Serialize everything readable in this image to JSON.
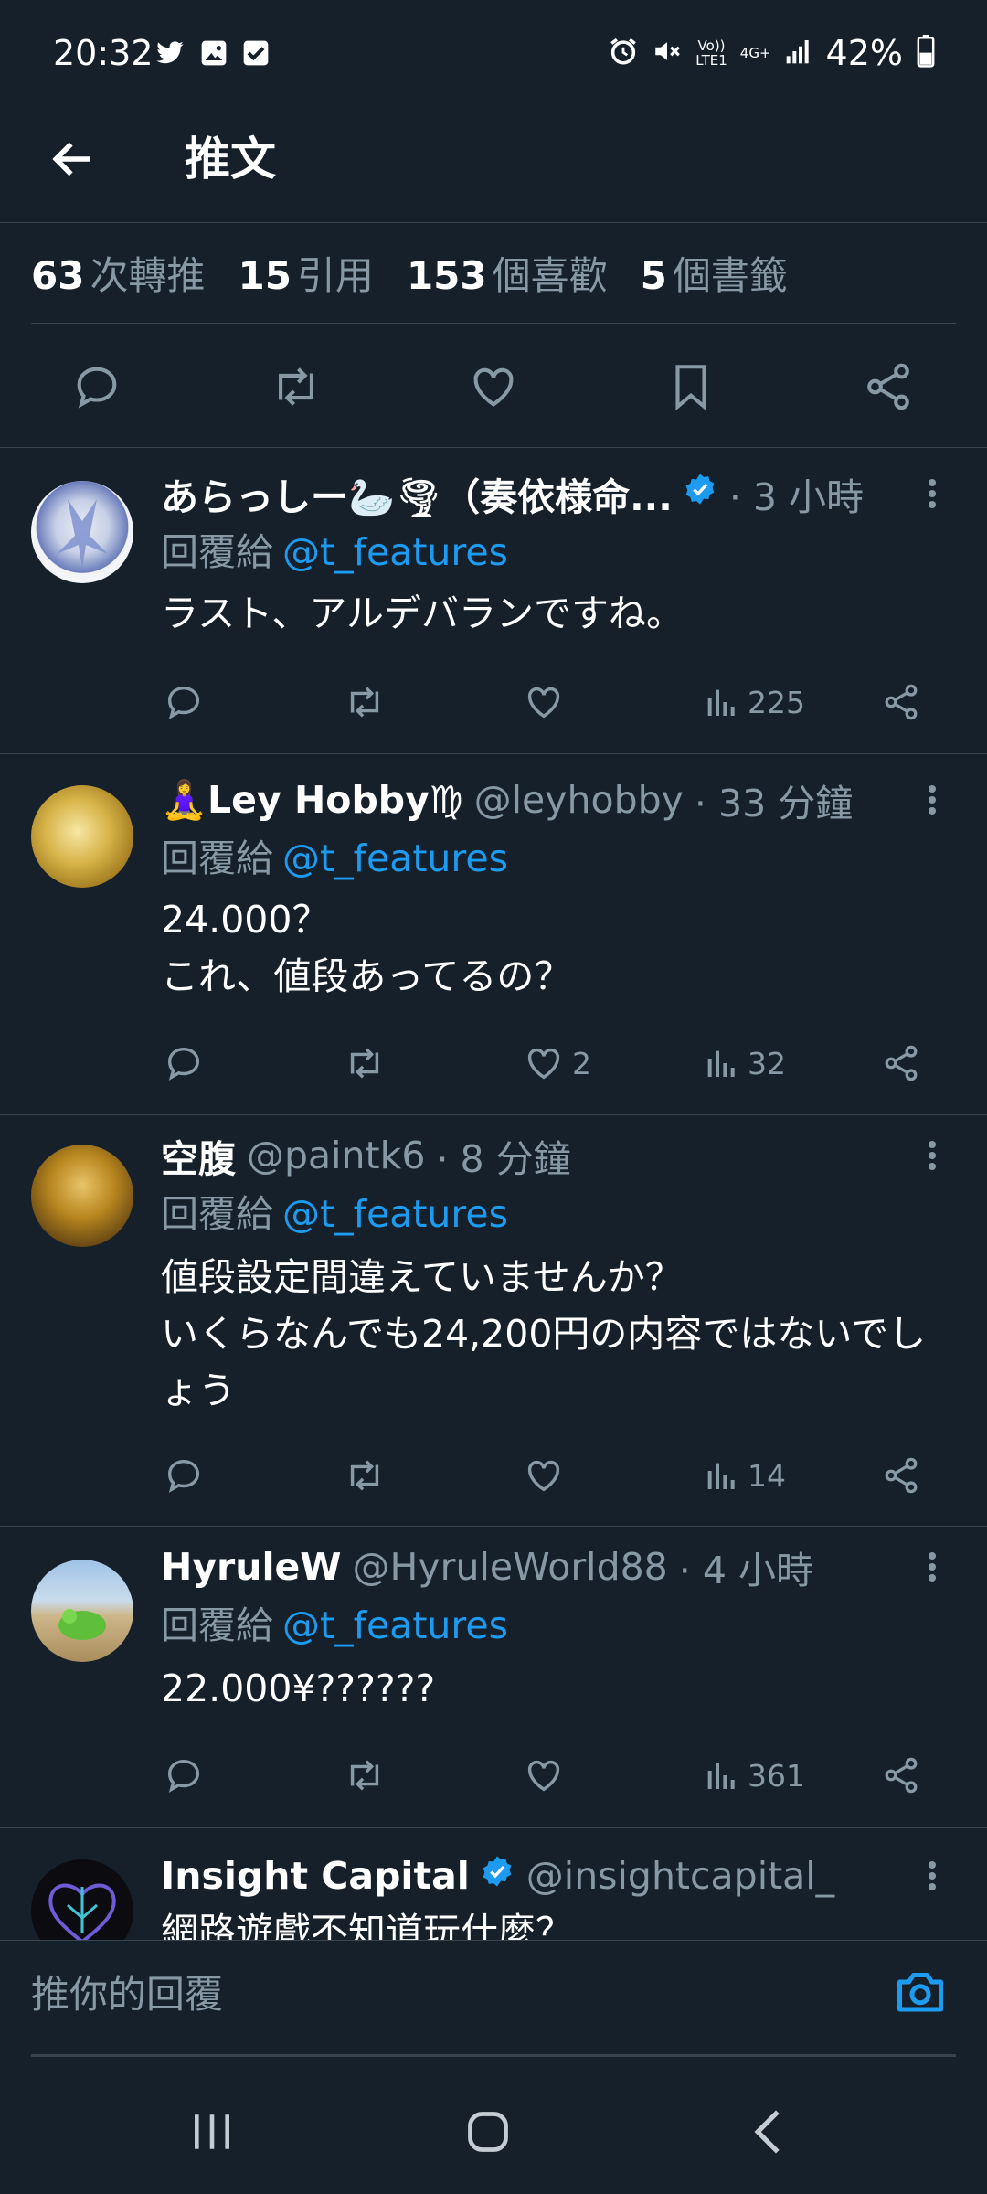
{
  "status_bar": {
    "time": "20:32",
    "battery_percent": "42%",
    "volte_label": "Vo))\nLTE1",
    "network_label": "4G+",
    "left_icons": [
      "twitter-icon",
      "gallery-icon",
      "checkbox-icon"
    ],
    "right_icons": [
      "alarm-icon",
      "mute-icon",
      "volte-icon",
      "4g-icon",
      "signal-icon",
      "battery-icon"
    ]
  },
  "header": {
    "title": "推文"
  },
  "stats": [
    {
      "value": "63",
      "label": "次轉推"
    },
    {
      "value": "15",
      "label": "引用"
    },
    {
      "value": "153",
      "label": "個喜歡"
    },
    {
      "value": "5",
      "label": "個書籤"
    }
  ],
  "action_bar_icons": [
    "reply-icon",
    "retweet-icon",
    "like-icon",
    "bookmark-icon",
    "share-icon"
  ],
  "reply_to_label": "回覆給",
  "replies": [
    {
      "name": "あらっしー🦢🌪（奏依様命...",
      "handle": "",
      "time": "· 3 小時",
      "verified": true,
      "mention": "@t_features",
      "text": "ラスト、アルデバランですね。",
      "likes": "",
      "views": "225"
    },
    {
      "name": "🧘‍♀️Ley Hobby♍",
      "handle": "@leyhobby",
      "time": "· 33 分鐘",
      "verified": false,
      "mention": "@t_features",
      "text": "24.000？\nこれ、値段あってるの？",
      "likes": "2",
      "views": "32"
    },
    {
      "name": "空腹",
      "handle": "@paintk6",
      "time": "· 8 分鐘",
      "verified": false,
      "mention": "@t_features",
      "text": "値段設定間違えていませんか？\nいくらなんでも24,200円の内容ではないでしょう",
      "likes": "",
      "views": "14"
    },
    {
      "name": "HyruleW",
      "handle": "@HyruleWorld88",
      "time": "· 4 小時",
      "verified": false,
      "mention": "@t_features",
      "text": "22.000¥??????",
      "likes": "",
      "views": "361"
    },
    {
      "name": "Insight Capital",
      "handle": "@insightcapital_",
      "time": "",
      "verified": true,
      "mention": "",
      "text": "網路遊戲不知道玩什麼？",
      "likes": "",
      "views": ""
    }
  ],
  "compose": {
    "placeholder": "推你的回覆"
  },
  "colors": {
    "background": "#15202b",
    "accent": "#1d9bf0",
    "muted": "#8899a6",
    "divider": "#38444d"
  }
}
